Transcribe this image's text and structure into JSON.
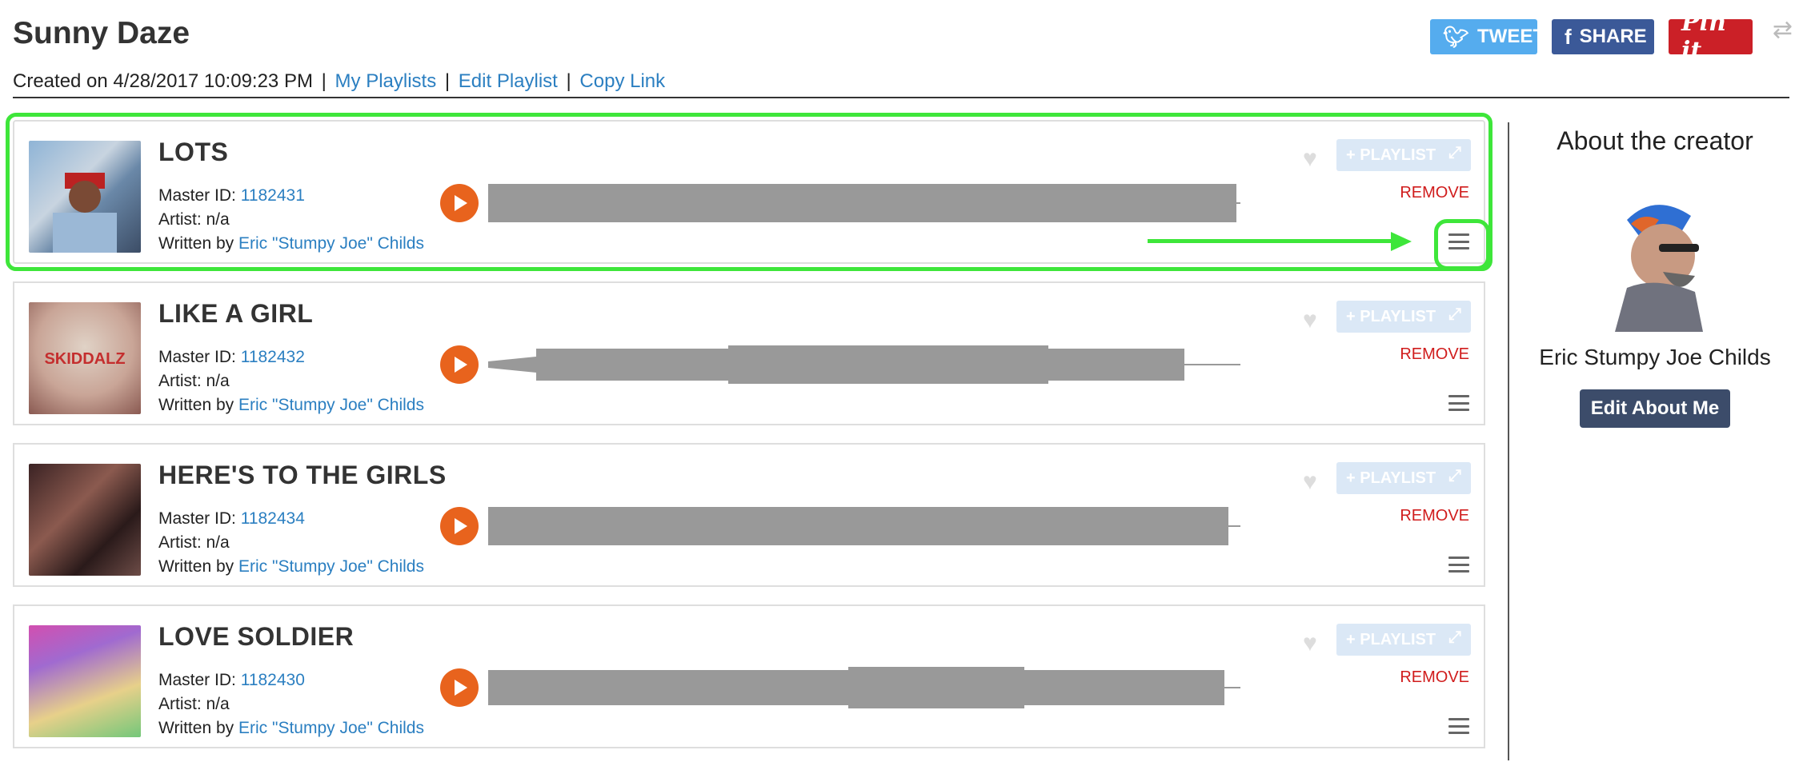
{
  "playlist": {
    "title": "Sunny Daze",
    "created_prefix": "Created on",
    "created_at": "4/28/2017 10:09:23 PM",
    "separator": "|",
    "links": {
      "my_playlists": "My Playlists",
      "edit_playlist": "Edit Playlist",
      "copy_link": "Copy Link"
    }
  },
  "social": {
    "tweet": "TWEET",
    "share": "SHARE",
    "pin": "Pin it",
    "tweet_icon": "bird-icon",
    "share_icon": "facebook-icon"
  },
  "labels": {
    "master_id": "Master ID:",
    "written_by": "Written by",
    "playlist_btn": "+ PLAYLIST",
    "remove": "REMOVE"
  },
  "songs": [
    {
      "title": "LOTS",
      "master_id": "1182431",
      "artist": "Artist: n/a",
      "writer": "Eric \"Stumpy Joe\" Childs",
      "thumb_text": ""
    },
    {
      "title": "LIKE A GIRL",
      "master_id": "1182432",
      "artist": "Artist: n/a",
      "writer": "Eric \"Stumpy Joe\" Childs",
      "thumb_text": "SKIDDALZ"
    },
    {
      "title": "HERE'S TO THE GIRLS",
      "master_id": "1182434",
      "artist": "Artist: n/a",
      "writer": "Eric \"Stumpy Joe\" Childs",
      "thumb_text": ""
    },
    {
      "title": "LOVE SOLDIER",
      "master_id": "1182430",
      "artist": "Artist: n/a",
      "writer": "Eric \"Stumpy Joe\" Childs",
      "thumb_text": ""
    }
  ],
  "creator": {
    "heading": "About the creator",
    "name": "Eric Stumpy Joe Childs",
    "edit_button": "Edit About Me"
  },
  "colors": {
    "accent_link": "#2b7fc1",
    "play": "#e8631d",
    "remove": "#d01c1c",
    "highlight": "#3ee63a"
  }
}
